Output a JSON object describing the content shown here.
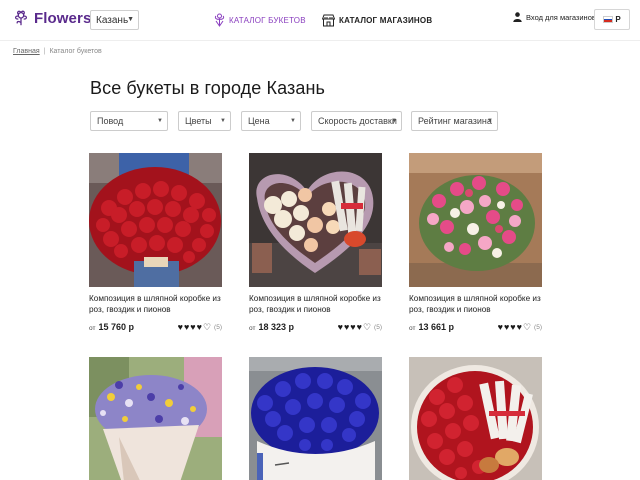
{
  "header": {
    "logo_text": "Flowers",
    "city": "Казань",
    "nav": [
      {
        "label": "КАТАЛОГ БУКЕТОВ",
        "icon": "bouquet-icon",
        "active": true
      },
      {
        "label": "КАТАЛОГ МАГАЗИНОВ",
        "icon": "store-icon",
        "active": false
      }
    ],
    "login_label": "Вход для магазинов",
    "language": "Р"
  },
  "breadcrumb": {
    "home": "Главная",
    "separator": "|",
    "current": "Каталог букетов"
  },
  "title": "Все букеты в городе Казань",
  "filters": [
    "Повод",
    "Цветы",
    "Цена",
    "Скорость доставки",
    "Рейтинг магазина"
  ],
  "products": [
    {
      "name": "Композиция в шляпной коробке из роз, гвоздик и пионов",
      "price_from": "от",
      "price": "15 760 р",
      "rating": 4,
      "reviews": "(5)"
    },
    {
      "name": "Композиция в шляпной коробке из роз, гвоздик и пионов",
      "price_from": "от",
      "price": "18 323 р",
      "rating": 4,
      "reviews": "(5)"
    },
    {
      "name": "Композиция в шляпной коробке из роз, гвоздик и пионов",
      "price_from": "от",
      "price": "13 661 р",
      "rating": 4,
      "reviews": "(5)"
    },
    {
      "name": "",
      "price_from": "",
      "price": "",
      "rating": 0,
      "reviews": ""
    },
    {
      "name": "",
      "price_from": "",
      "price": "",
      "rating": 0,
      "reviews": ""
    },
    {
      "name": "",
      "price_from": "",
      "price": "",
      "rating": 0,
      "reviews": ""
    }
  ],
  "colors": {
    "brand": "#5a2a8c",
    "nav_active": "#8a3fbf",
    "text": "#222222"
  }
}
